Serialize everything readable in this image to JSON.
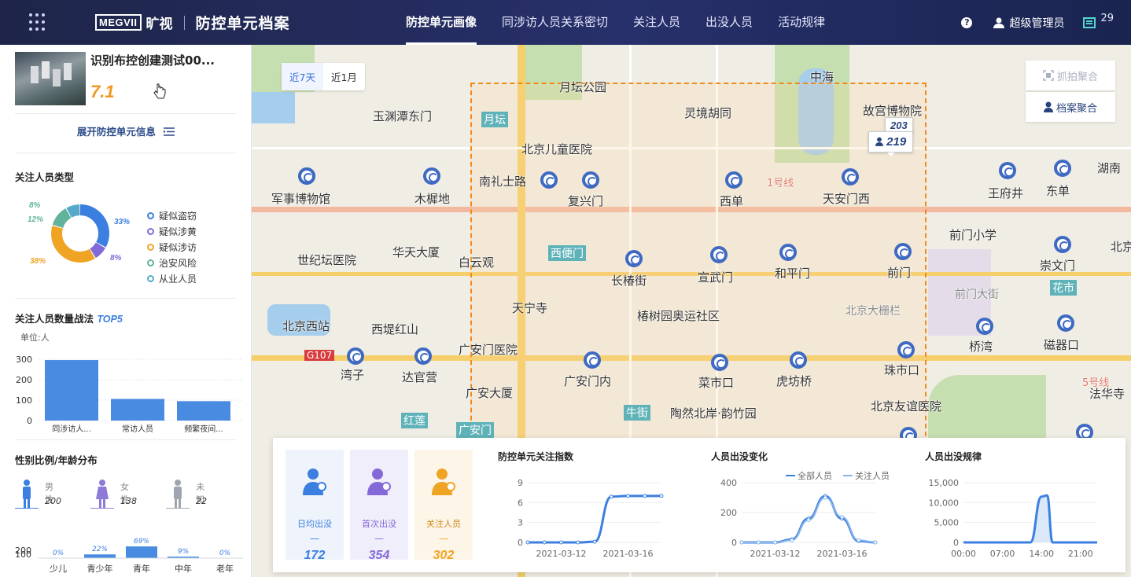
{
  "header": {
    "logo_text": "MEGVII",
    "logo_cn": "旷视",
    "app_title": "防控单元档案",
    "tabs": [
      {
        "label": "防控单元画像",
        "active": true
      },
      {
        "label": "同涉访人员关系密切",
        "active": false
      },
      {
        "label": "关注人员",
        "active": false
      },
      {
        "label": "出没人员",
        "active": false
      },
      {
        "label": "活动规律",
        "active": false
      }
    ],
    "help": "?",
    "user": "超级管理员",
    "msg_count": "29"
  },
  "unit": {
    "name": "识别布控创建测试00...",
    "score": "7.1",
    "expand_label": "展开防控单元信息"
  },
  "focus_types": {
    "title": "关注人员类型",
    "items": [
      {
        "name": "疑似盗窃",
        "pct": "33%",
        "value": 33,
        "color": "#3b7fe0"
      },
      {
        "name": "疑似涉黄",
        "pct": "8%",
        "value": 8,
        "color": "#8469d8"
      },
      {
        "name": "疑似涉访",
        "pct": "38%",
        "value": 38,
        "color": "#f0a424"
      },
      {
        "name": "治安风险",
        "pct": "12%",
        "value": 12,
        "color": "#62b39c"
      },
      {
        "name": "从业人员",
        "pct": "8%",
        "value": 8,
        "color": "#58a9c9"
      }
    ]
  },
  "top5": {
    "title": "关注人员数量战法",
    "tag": "TOP5",
    "unit": "单位:人",
    "chart_data": {
      "type": "bar",
      "categories": [
        "同涉访人...",
        "常访人员",
        "频繁夜间..."
      ],
      "values": [
        296,
        106,
        95
      ],
      "ylim": [
        0,
        300
      ],
      "yticks": [
        "0",
        "100",
        "200",
        "300"
      ]
    }
  },
  "gender": {
    "title": "性别比例/年龄分布",
    "items": [
      {
        "label": "男性",
        "value": "200",
        "color": "#3b7fe0"
      },
      {
        "label": "女性",
        "value": "138",
        "color": "#8f7ad8"
      },
      {
        "label": "未知",
        "value": "22",
        "color": "#a0a6b0"
      }
    ]
  },
  "age": {
    "chart_data": {
      "type": "bar",
      "categories": [
        "少儿",
        "青少年",
        "青年",
        "中年",
        "老年"
      ],
      "values": [
        0,
        22,
        69,
        9,
        0
      ],
      "labels": [
        "0%",
        "22%",
        "69%",
        "9%",
        "0%"
      ],
      "yticks": [
        "100",
        "200"
      ]
    }
  },
  "map": {
    "range_tabs": [
      {
        "label": "近7天",
        "active": true
      },
      {
        "label": "近1月",
        "active": false
      }
    ],
    "agg_snap": "抓拍聚合",
    "agg_file": "档案聚合",
    "marker_back": "203",
    "marker_front": "219",
    "labels": [
      "月坛公园",
      "灵境胡同",
      "玉渊潭东门",
      "月坛",
      "北京儿童医院",
      "中海",
      "故宫博物院",
      "军事博物馆",
      "木樨地",
      "南礼士路",
      "复兴门",
      "西单",
      "天安门西",
      "王府井",
      "东单",
      "湖南",
      "前门小学",
      "世纪坛医院",
      "华天大厦",
      "白云观",
      "西便门",
      "长椿街",
      "宣武门",
      "和平门",
      "前门",
      "崇文门",
      "花市",
      "北京西站",
      "天宁寺",
      "椿树园奥运社区",
      "北京大栅栏",
      "前门大街",
      "西堤红山",
      "广安门医院",
      "湾子",
      "达官营",
      "广安门内",
      "菜市口",
      "虎坊桥",
      "珠市口",
      "桥湾",
      "磁器口",
      "法华寺",
      "广安大厦",
      "陶然北岸·韵竹园",
      "北京友谊医院",
      "牛街",
      "红莲",
      "广安门",
      "G107",
      "1号线",
      "5号线",
      "北京"
    ]
  },
  "metrics": {
    "kpis": [
      {
        "label": "日均出没",
        "dash": "—",
        "value": "172",
        "color": "#3b7fe0"
      },
      {
        "label": "首次出没",
        "dash": "—",
        "value": "354",
        "color": "#8469d8"
      },
      {
        "label": "关注人员",
        "dash": "—",
        "value": "302",
        "color": "#f0a424"
      }
    ],
    "index_chart": {
      "title": "防控单元关注指数",
      "chart_data": {
        "type": "line",
        "x": [
          "2021-03-10",
          "2021-03-11",
          "2021-03-12",
          "2021-03-13",
          "2021-03-14",
          "2021-03-15",
          "2021-03-16",
          "2021-03-17",
          "2021-03-18"
        ],
        "values": [
          0,
          0,
          0,
          0,
          0.1,
          6.9,
          7,
          7,
          7
        ],
        "yticks": [
          "0",
          "3",
          "6",
          "9"
        ],
        "xlabels": [
          "2021-03-12",
          "2021-03-16"
        ],
        "ylim": [
          0,
          9
        ]
      }
    },
    "change_chart": {
      "title": "人员出没变化",
      "legend": [
        "全部人员",
        "关注人员"
      ],
      "chart_data": {
        "type": "line",
        "x": [
          "2021-03-10",
          "2021-03-11",
          "2021-03-12",
          "2021-03-13",
          "2021-03-14",
          "2021-03-15",
          "2021-03-16",
          "2021-03-17",
          "2021-03-18"
        ],
        "series": [
          {
            "name": "全部人员",
            "values": [
              0,
              0,
              0,
              20,
              160,
              310,
              160,
              10,
              0
            ]
          },
          {
            "name": "关注人员",
            "values": [
              0,
              0,
              0,
              15,
              150,
              300,
              170,
              15,
              0
            ]
          }
        ],
        "yticks": [
          "0",
          "200",
          "400"
        ],
        "xlabels": [
          "2021-03-12",
          "2021-03-16"
        ],
        "ylim": [
          0,
          400
        ]
      }
    },
    "pattern_chart": {
      "title": "人员出没规律",
      "chart_data": {
        "type": "area",
        "x": [
          "00:00",
          "02:00",
          "04:00",
          "06:00",
          "08:00",
          "10:00",
          "12:00",
          "14:00",
          "15:00",
          "16:00",
          "18:00",
          "20:00",
          "22:00",
          "24:00"
        ],
        "values": [
          0,
          0,
          0,
          0,
          0,
          0,
          0,
          11500,
          11800,
          0,
          0,
          0,
          0,
          0
        ],
        "yticks": [
          "0",
          "5,000",
          "10,000",
          "15,000"
        ],
        "xlabels": [
          "00:00",
          "07:00",
          "14:00",
          "21:00"
        ],
        "ylim": [
          0,
          15000
        ]
      }
    }
  }
}
